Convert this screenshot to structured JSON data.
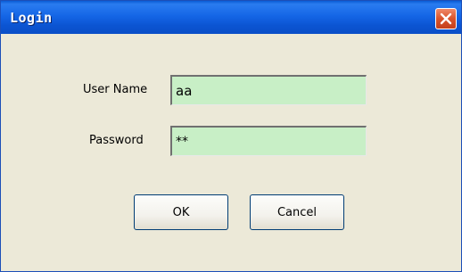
{
  "window": {
    "title": "Login"
  },
  "form": {
    "username_label": "User Name",
    "username_value": "aa",
    "password_label": "Password",
    "password_value": "**"
  },
  "buttons": {
    "ok_label": "OK",
    "cancel_label": "Cancel"
  },
  "icons": {
    "close": "close-icon"
  },
  "colors": {
    "titlebar": "#0a5cd6",
    "field_background": "#c8efc6",
    "dialog_background": "#ece9d8",
    "close_button": "#d9542c"
  }
}
